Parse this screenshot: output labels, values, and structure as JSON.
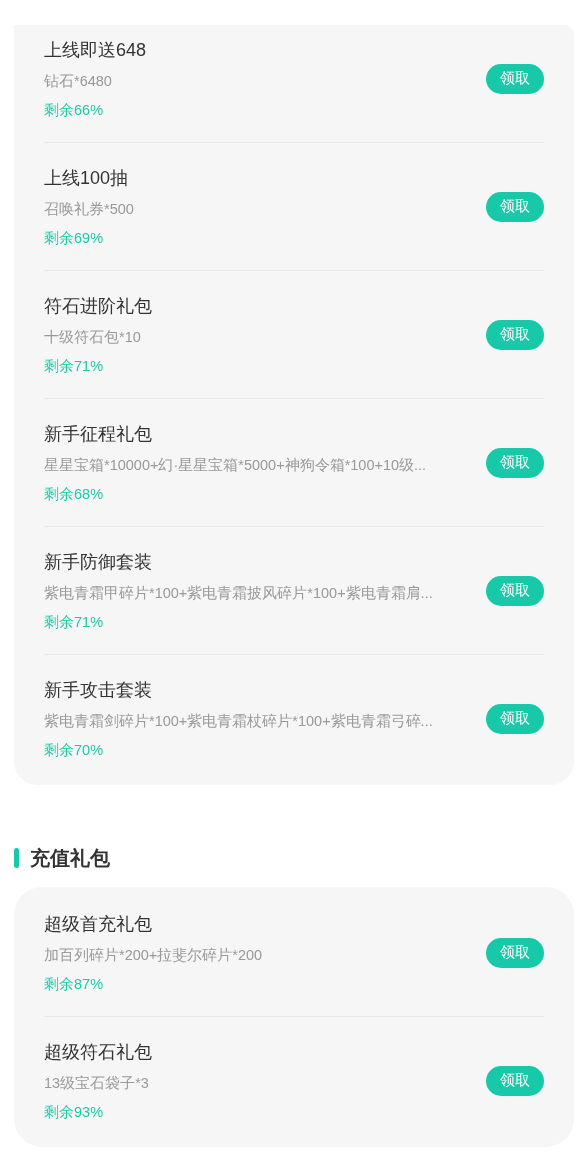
{
  "sections": [
    {
      "packs": [
        {
          "name": "上线即送648",
          "contents": "钻石*6480",
          "remaining": "剩余66%",
          "button": "领取"
        },
        {
          "name": "上线100抽",
          "contents": "召唤礼券*500",
          "remaining": "剩余69%",
          "button": "领取"
        },
        {
          "name": "符石进阶礼包",
          "contents": "十级符石包*10",
          "remaining": "剩余71%",
          "button": "领取"
        },
        {
          "name": "新手征程礼包",
          "contents": "星星宝箱*10000+幻·星星宝箱*5000+神狗令箱*100+10级...",
          "remaining": "剩余68%",
          "button": "领取"
        },
        {
          "name": "新手防御套装",
          "contents": "紫电青霜甲碎片*100+紫电青霜披风碎片*100+紫电青霜肩...",
          "remaining": "剩余71%",
          "button": "领取"
        },
        {
          "name": "新手攻击套装",
          "contents": "紫电青霜剑碎片*100+紫电青霜杖碎片*100+紫电青霜弓碎...",
          "remaining": "剩余70%",
          "button": "领取"
        }
      ]
    },
    {
      "heading": "充值礼包",
      "packs": [
        {
          "name": "超级首充礼包",
          "contents": "加百列碎片*200+拉斐尔碎片*200",
          "remaining": "剩余87%",
          "button": "领取"
        },
        {
          "name": "超级符石礼包",
          "contents": "13级宝石袋子*3",
          "remaining": "剩余93%",
          "button": "领取"
        }
      ]
    }
  ]
}
